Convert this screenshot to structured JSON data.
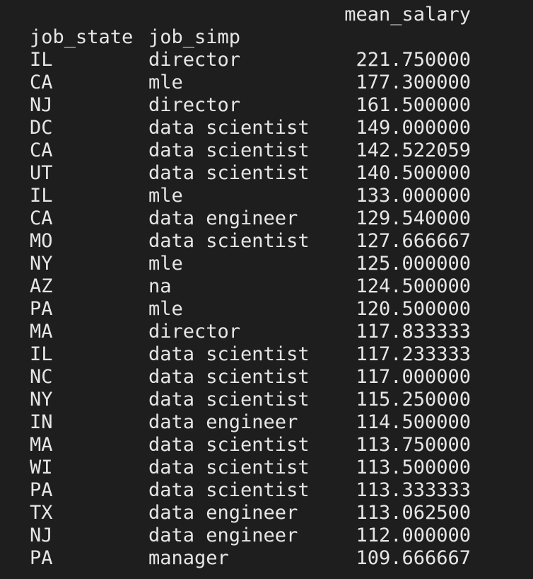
{
  "header": {
    "value_column": "mean_salary",
    "index_columns": [
      "job_state",
      "job_simp"
    ]
  },
  "rows": [
    {
      "job_state": "IL",
      "job_simp": "director",
      "mean_salary": "221.750000"
    },
    {
      "job_state": "CA",
      "job_simp": "mle",
      "mean_salary": "177.300000"
    },
    {
      "job_state": "NJ",
      "job_simp": "director",
      "mean_salary": "161.500000"
    },
    {
      "job_state": "DC",
      "job_simp": "data scientist",
      "mean_salary": "149.000000"
    },
    {
      "job_state": "CA",
      "job_simp": "data scientist",
      "mean_salary": "142.522059"
    },
    {
      "job_state": "UT",
      "job_simp": "data scientist",
      "mean_salary": "140.500000"
    },
    {
      "job_state": "IL",
      "job_simp": "mle",
      "mean_salary": "133.000000"
    },
    {
      "job_state": "CA",
      "job_simp": "data engineer",
      "mean_salary": "129.540000"
    },
    {
      "job_state": "MO",
      "job_simp": "data scientist",
      "mean_salary": "127.666667"
    },
    {
      "job_state": "NY",
      "job_simp": "mle",
      "mean_salary": "125.000000"
    },
    {
      "job_state": "AZ",
      "job_simp": "na",
      "mean_salary": "124.500000"
    },
    {
      "job_state": "PA",
      "job_simp": "mle",
      "mean_salary": "120.500000"
    },
    {
      "job_state": "MA",
      "job_simp": "director",
      "mean_salary": "117.833333"
    },
    {
      "job_state": "IL",
      "job_simp": "data scientist",
      "mean_salary": "117.233333"
    },
    {
      "job_state": "NC",
      "job_simp": "data scientist",
      "mean_salary": "117.000000"
    },
    {
      "job_state": "NY",
      "job_simp": "data scientist",
      "mean_salary": "115.250000"
    },
    {
      "job_state": "IN",
      "job_simp": "data engineer",
      "mean_salary": "114.500000"
    },
    {
      "job_state": "MA",
      "job_simp": "data scientist",
      "mean_salary": "113.750000"
    },
    {
      "job_state": "WI",
      "job_simp": "data scientist",
      "mean_salary": "113.500000"
    },
    {
      "job_state": "PA",
      "job_simp": "data scientist",
      "mean_salary": "113.333333"
    },
    {
      "job_state": "TX",
      "job_simp": "data engineer",
      "mean_salary": "113.062500"
    },
    {
      "job_state": "NJ",
      "job_simp": "data engineer",
      "mean_salary": "112.000000"
    },
    {
      "job_state": "PA",
      "job_simp": "manager",
      "mean_salary": "109.666667"
    }
  ],
  "colors": {
    "background": "#1e1e1e",
    "text": "#e6e6e6"
  }
}
